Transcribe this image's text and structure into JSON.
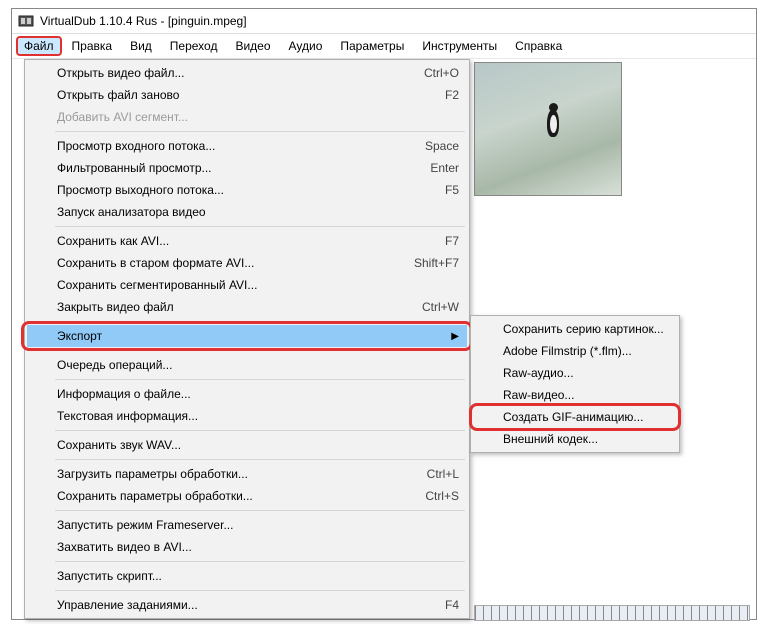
{
  "title": "VirtualDub 1.10.4 Rus - [pinguin.mpeg]",
  "menubar": {
    "file": "Файл",
    "edit": "Правка",
    "view": "Вид",
    "go": "Переход",
    "video": "Видео",
    "audio": "Аудио",
    "options": "Параметры",
    "tools": "Инструменты",
    "help": "Справка"
  },
  "fileMenu": {
    "open": {
      "label": "Открыть видео файл...",
      "shortcut": "Ctrl+O"
    },
    "reopen": {
      "label": "Открыть файл заново",
      "shortcut": "F2"
    },
    "appendAvi": {
      "label": "Добавить AVI сегмент..."
    },
    "previewIn": {
      "label": "Просмотр входного потока...",
      "shortcut": "Space"
    },
    "previewFiltered": {
      "label": "Фильтрованный просмотр...",
      "shortcut": "Enter"
    },
    "previewOut": {
      "label": "Просмотр выходного потока...",
      "shortcut": "F5"
    },
    "runAnalysis": {
      "label": "Запуск анализатора видео"
    },
    "saveAvi": {
      "label": "Сохранить как AVI...",
      "shortcut": "F7"
    },
    "saveOldAvi": {
      "label": "Сохранить в старом формате AVI...",
      "shortcut": "Shift+F7"
    },
    "saveSegmented": {
      "label": "Сохранить сегментированный AVI..."
    },
    "close": {
      "label": "Закрыть видео файл",
      "shortcut": "Ctrl+W"
    },
    "export": {
      "label": "Экспорт"
    },
    "queue": {
      "label": "Очередь операций..."
    },
    "fileInfo": {
      "label": "Информация о файле..."
    },
    "textInfo": {
      "label": "Текстовая информация..."
    },
    "saveWav": {
      "label": "Сохранить звук WAV..."
    },
    "loadProcessing": {
      "label": "Загрузить параметры обработки...",
      "shortcut": "Ctrl+L"
    },
    "saveProcessing": {
      "label": "Сохранить параметры обработки...",
      "shortcut": "Ctrl+S"
    },
    "startFrameserver": {
      "label": "Запустить режим Frameserver..."
    },
    "captureAvi": {
      "label": "Захватить видео в AVI..."
    },
    "runScript": {
      "label": "Запустить скрипт..."
    },
    "jobControl": {
      "label": "Управление заданиями...",
      "shortcut": "F4"
    }
  },
  "exportMenu": {
    "imageSequence": "Сохранить серию картинок...",
    "filmstrip": "Adobe Filmstrip (*.flm)...",
    "rawAudio": "Raw-аудио...",
    "rawVideo": "Raw-видео...",
    "createGif": "Создать GIF-анимацию...",
    "externalCodec": "Внешний кодек..."
  }
}
